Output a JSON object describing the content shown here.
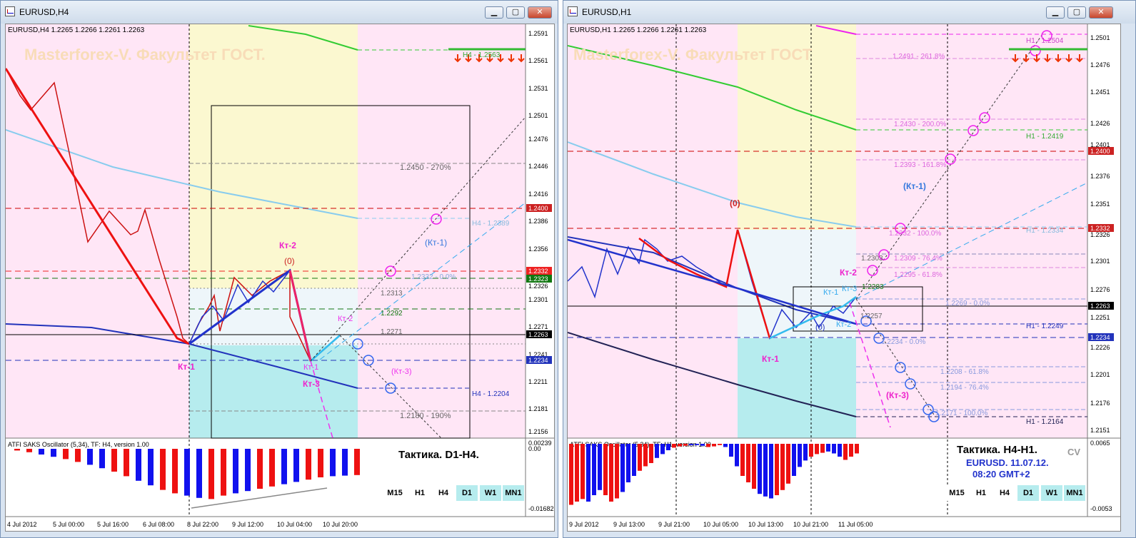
{
  "colors": {
    "accent_red": "#cc0000",
    "accent_blue": "#0000cc",
    "magenta": "#ee00ee",
    "sky": "#33aaee",
    "pink_bg": "#ffe6f6",
    "yellow_bg": "#fbf8d0",
    "cyan_bg": "#b6ecee"
  },
  "left": {
    "title": "EURUSD,H4",
    "symbol_line": "EURUSD,H4  1.2265 1.2266 1.2261 1.2263",
    "watermark": "Masterforex-V. Факультет ГОСТ.",
    "prices": [
      "1.2591",
      "1.2561",
      "1.2531",
      "1.2501",
      "1.2476",
      "1.2446",
      "1.2416",
      "1.2386",
      "1.2356",
      "1.2326",
      "1.2301",
      "1.2271",
      "1.2241",
      "1.2211",
      "1.2181",
      "1.2156"
    ],
    "tags": {
      "r1": "1.2400",
      "r2": "1.2332",
      "g1": "1.2323",
      "k1": "1.2263",
      "b1": "1.2234"
    },
    "labels": {
      "h4_top": "H4 - 1.2563",
      "l270": "1.2450 - 270%",
      "h4_389": "H4 - 1.2389",
      "kt1p": "(Кт-1)",
      "l00": "1.2332 - 0.0%",
      "l2313": "1.2313",
      "l2292": "1.2292",
      "l2271": "1.2271",
      "kt2": "Кт-2",
      "zero": "(0)",
      "kt2b": "Кт-2",
      "kt1b": "Кт-1",
      "kt3p": "(Кт-3)",
      "kt1": "Кт-1",
      "kt3": "Кт-3",
      "h4_204": "H4 - 1.2204",
      "l190": "1.2180 - 190%"
    },
    "osc": {
      "name": "ATFI SAKS Oscillator (5,34), TF: H4, version 1.00",
      "top": "0.00239",
      "zero": "0.00",
      "bottom": "-0.01682",
      "tactic": "Тактика. D1-H4.",
      "bars": [
        0.03,
        0.06,
        0.1,
        0.14,
        0.18,
        0.23,
        0.28,
        0.34,
        0.4,
        0.48,
        0.56,
        0.64,
        0.72,
        0.78,
        0.82,
        0.86,
        0.88,
        0.82,
        0.78,
        0.74,
        0.7,
        0.66,
        0.62,
        0.58,
        0.54,
        0.5,
        0.48,
        0.47,
        0.46
      ]
    },
    "dates": [
      "4 Jul 2012",
      "5 Jul 00:00",
      "5 Jul 16:00",
      "6 Jul 08:00",
      "8 Jul 22:00",
      "9 Jul 12:00",
      "10 Jul 04:00",
      "10 Jul 20:00"
    ],
    "tfs": [
      "M15",
      "H1",
      "H4",
      "D1",
      "W1",
      "MN1"
    ]
  },
  "right": {
    "title": "EURUSD,H1",
    "symbol_line": "EURUSD,H1  1.2265 1.2266 1.2261 1.2263",
    "watermark": "Masterforex-V. Факультет ГОСТ",
    "prices": [
      "1.2501",
      "1.2476",
      "1.2451",
      "1.2426",
      "1.2401",
      "1.2376",
      "1.2351",
      "1.2326",
      "1.2301",
      "1.2276",
      "1.2251",
      "1.2226",
      "1.2201",
      "1.2176",
      "1.2151"
    ],
    "tags": {
      "r1": "1.2400",
      "r2": "1.2332",
      "k1": "1.2263",
      "b1": "1.2234"
    },
    "labels": {
      "h1_504": "H1 - 1.2504",
      "l2618": "1.2491 - 261.8%",
      "l200": "1.2430 - 200.0%",
      "h1_419": "H1 - 1.2419",
      "l1618": "1.2393 - 161.8%",
      "kt1p": "(Кт-1)",
      "zero": "(0)",
      "l100": "1.2332 - 100.0%",
      "h1_334": "H1 - 1.2334",
      "l2303": "1.2303",
      "l764": "1.2309 - 76.4%",
      "kt2": "Кт-2",
      "l618": "1.2295 - 61.8%",
      "l2283": "1.2283",
      "kt1b": "Кт-1",
      "kt3b": "Кт-3",
      "l2269": "1.2269 - 0.0%",
      "l2257": "1.2257",
      "zerob": "(0)",
      "kt2b": "Кт-2",
      "h1_249": "H1 - 1.2249",
      "kt1": "Кт-1",
      "l00": "1.2234 - 0.0%",
      "l618b": "1.2208 - 61.8%",
      "l764b": "1.2194 - 76.4%",
      "kt3p": "(Кт-3)",
      "l1000": "1.2171 - 100.0%",
      "h1_164": "H1 - 1.2164"
    },
    "osc": {
      "name": "ATFI SAKS Oscillator (5,34), TF: H1, version 1.00",
      "top": "0.0065",
      "bottom": "-0.0053",
      "tactic": "Тактика. H4-H1.",
      "sub1": "EURUSD. 11.07.12.",
      "sub2": "08:20  GMT+2",
      "cv": "CV",
      "bars": [
        0.95,
        0.9,
        0.86,
        0.9,
        0.8,
        0.72,
        0.8,
        0.9,
        0.85,
        0.75,
        0.6,
        0.5,
        0.42,
        0.35,
        0.3,
        0.22,
        0.16,
        0.1,
        0.06,
        0.04,
        0.03,
        0.02,
        0.02,
        0.03,
        0.05,
        0.04,
        0.02,
        0.05,
        0.2,
        0.35,
        0.5,
        0.6,
        0.7,
        0.78,
        0.82,
        0.85,
        0.8,
        0.72,
        0.62,
        0.5,
        0.36,
        0.26,
        0.2,
        0.16,
        0.14,
        0.12,
        0.15,
        0.2,
        0.25,
        0.2,
        0.15
      ]
    },
    "dates": [
      "9 Jul 2012",
      "9 Jul 13:00",
      "9 Jul 21:00",
      "10 Jul 05:00",
      "10 Jul 13:00",
      "10 Jul 21:00",
      "11 Jul 05:00"
    ],
    "tfs": [
      "M15",
      "H1",
      "H4",
      "D1",
      "W1",
      "MN1"
    ]
  },
  "buttons": {
    "min": "▁",
    "max": "▢",
    "close": "✕"
  }
}
